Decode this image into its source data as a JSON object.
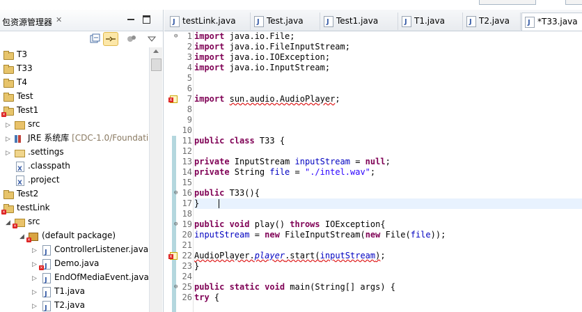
{
  "explorer": {
    "title": "包资源管理器",
    "close": "✕",
    "tree": [
      {
        "label": "T3",
        "depth": 0,
        "icon": "project",
        "arrow": "",
        "error": false
      },
      {
        "label": "T33",
        "depth": 0,
        "icon": "project",
        "arrow": "",
        "error": false
      },
      {
        "label": "T4",
        "depth": 0,
        "icon": "project",
        "arrow": "",
        "error": false
      },
      {
        "label": "Test",
        "depth": 0,
        "icon": "project",
        "arrow": "",
        "error": false
      },
      {
        "label": "Test1",
        "depth": 0,
        "icon": "project",
        "arrow": "",
        "error": true
      },
      {
        "label": "src",
        "depth": 1,
        "icon": "pkgfolder",
        "arrow": "▷",
        "error": false
      },
      {
        "label": "JRE 系统库",
        "extra": " [CDC-1.0/Foundati",
        "depth": 1,
        "icon": "library",
        "arrow": "▷",
        "error": false
      },
      {
        "label": ".settings",
        "depth": 1,
        "icon": "folder",
        "arrow": "▷",
        "error": false
      },
      {
        "label": ".classpath",
        "depth": 1,
        "icon": "file",
        "arrow": "",
        "error": false
      },
      {
        "label": ".project",
        "depth": 1,
        "icon": "file",
        "arrow": "",
        "error": false
      },
      {
        "label": "Test2",
        "depth": 0,
        "icon": "project",
        "arrow": "",
        "error": false
      },
      {
        "label": "testLink",
        "depth": 0,
        "icon": "project",
        "arrow": "",
        "error": true
      },
      {
        "label": "src",
        "depth": 1,
        "icon": "pkgfolder",
        "arrow": "◢",
        "error": true
      },
      {
        "label": "(default package)",
        "depth": 2,
        "icon": "package",
        "arrow": "◢",
        "error": true
      },
      {
        "label": "ControllerListener.java",
        "depth": 3,
        "icon": "java",
        "arrow": "▷",
        "error": false
      },
      {
        "label": "Demo.java",
        "depth": 3,
        "icon": "java",
        "arrow": "▷",
        "error": true
      },
      {
        "label": "EndOfMediaEvent.java",
        "depth": 3,
        "icon": "java",
        "arrow": "▷",
        "error": false
      },
      {
        "label": "T1.java",
        "depth": 3,
        "icon": "java",
        "arrow": "▷",
        "error": false
      },
      {
        "label": "T2.java",
        "depth": 3,
        "icon": "java",
        "arrow": "▷",
        "error": false
      }
    ]
  },
  "tabs": [
    {
      "label": "testLink.java",
      "active": false
    },
    {
      "label": "Test.java",
      "active": false
    },
    {
      "label": "Test1.java",
      "active": false
    },
    {
      "label": "T1.java",
      "active": false
    },
    {
      "label": "T2.java",
      "active": false
    },
    {
      "label": "*T33.java",
      "active": true
    }
  ],
  "tab_close": "✕",
  "code": [
    {
      "n": "1",
      "fold": "⊖",
      "html": "<span class='kw'>import</span> java.io.File;"
    },
    {
      "n": "2",
      "fold": "",
      "html": "<span class='kw'>import</span> java.io.FileInputStream;"
    },
    {
      "n": "3",
      "fold": "",
      "html": "<span class='kw'>import</span> java.io.IOException;"
    },
    {
      "n": "4",
      "fold": "",
      "html": "<span class='kw'>import</span> java.io.InputStream;"
    },
    {
      "n": "5",
      "fold": "",
      "html": ""
    },
    {
      "n": "6",
      "fold": "",
      "html": ""
    },
    {
      "n": "7",
      "fold": "",
      "html": "<span class='kw'>import</span> <span class='err'>sun.audio.AudioPlayer</span>;",
      "error": true
    },
    {
      "n": "8",
      "fold": "",
      "html": ""
    },
    {
      "n": "9",
      "fold": "",
      "html": ""
    },
    {
      "n": "10",
      "fold": "",
      "html": ""
    },
    {
      "n": "11",
      "fold": "",
      "html": "<span class='kw'>public class</span> T33 {"
    },
    {
      "n": "12",
      "fold": "",
      "html": ""
    },
    {
      "n": "13",
      "fold": "",
      "html": "<span class='kw'>private</span> InputStream <span class='fld'>inputStream</span> = <span class='kw'>null</span>;"
    },
    {
      "n": "14",
      "fold": "",
      "html": "<span class='kw'>private</span> String <span class='fld'>file</span> = <span class='str'>\"./intel.wav\"</span>;"
    },
    {
      "n": "15",
      "fold": "",
      "html": ""
    },
    {
      "n": "16",
      "fold": "⊖",
      "html": "<span class='kw'>public</span> T33(){"
    },
    {
      "n": "17",
      "fold": "",
      "html": "}"
    },
    {
      "n": "18",
      "fold": "",
      "html": ""
    },
    {
      "n": "19",
      "fold": "⊖",
      "html": "<span class='kw'>public void</span> play() <span class='kw'>throws</span> IOException{"
    },
    {
      "n": "20",
      "fold": "",
      "html": "<span class='fld'>inputStream</span> = <span class='kw'>new</span> FileInputStream(<span class='kw'>new</span> File(<span class='fld'>file</span>));"
    },
    {
      "n": "21",
      "fold": "",
      "html": ""
    },
    {
      "n": "22",
      "fold": "",
      "html": "<span class='err'>AudioPlayer.<span class='sfld'>player</span>.start(<span class='fld'>inputStream</span>)</span>;",
      "error": true
    },
    {
      "n": "23",
      "fold": "",
      "html": "}"
    },
    {
      "n": "24",
      "fold": "",
      "html": ""
    },
    {
      "n": "25",
      "fold": "⊖",
      "html": "<span class='kw'>public static void</span> main(String[] args) {"
    },
    {
      "n": "26",
      "fold": "",
      "html": "<span class='kw'>try</span> {"
    }
  ],
  "colors": {
    "keyword": "#7f0055",
    "string": "#2a00ff",
    "field": "#0000c0",
    "error": "#e02020",
    "current_line": "#e8f2fe",
    "change_bar": "#b4d7de"
  }
}
